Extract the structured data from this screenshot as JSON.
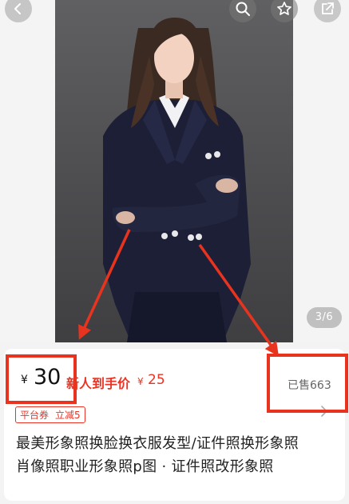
{
  "gallery": {
    "page_indicator": "3/6",
    "icons": {
      "back": "chevron-left-icon",
      "search": "search-icon",
      "favorite": "star-icon",
      "share": "share-icon"
    }
  },
  "product": {
    "currency": "¥",
    "price": "30",
    "newbie_label": "新人到手价",
    "newbie_currency": "¥",
    "newbie_price": "25",
    "sold": "已售663",
    "coupon_tag": "平台券",
    "coupon_value": "立减5",
    "title_line1": "最美形象照换脸换衣服发型/证件照换形象照",
    "title_line2": "肖像照职业形象照p图 · 证件照改形象照"
  },
  "colors": {
    "accent_red": "#ea3324",
    "annotation_red": "#e8331f"
  }
}
